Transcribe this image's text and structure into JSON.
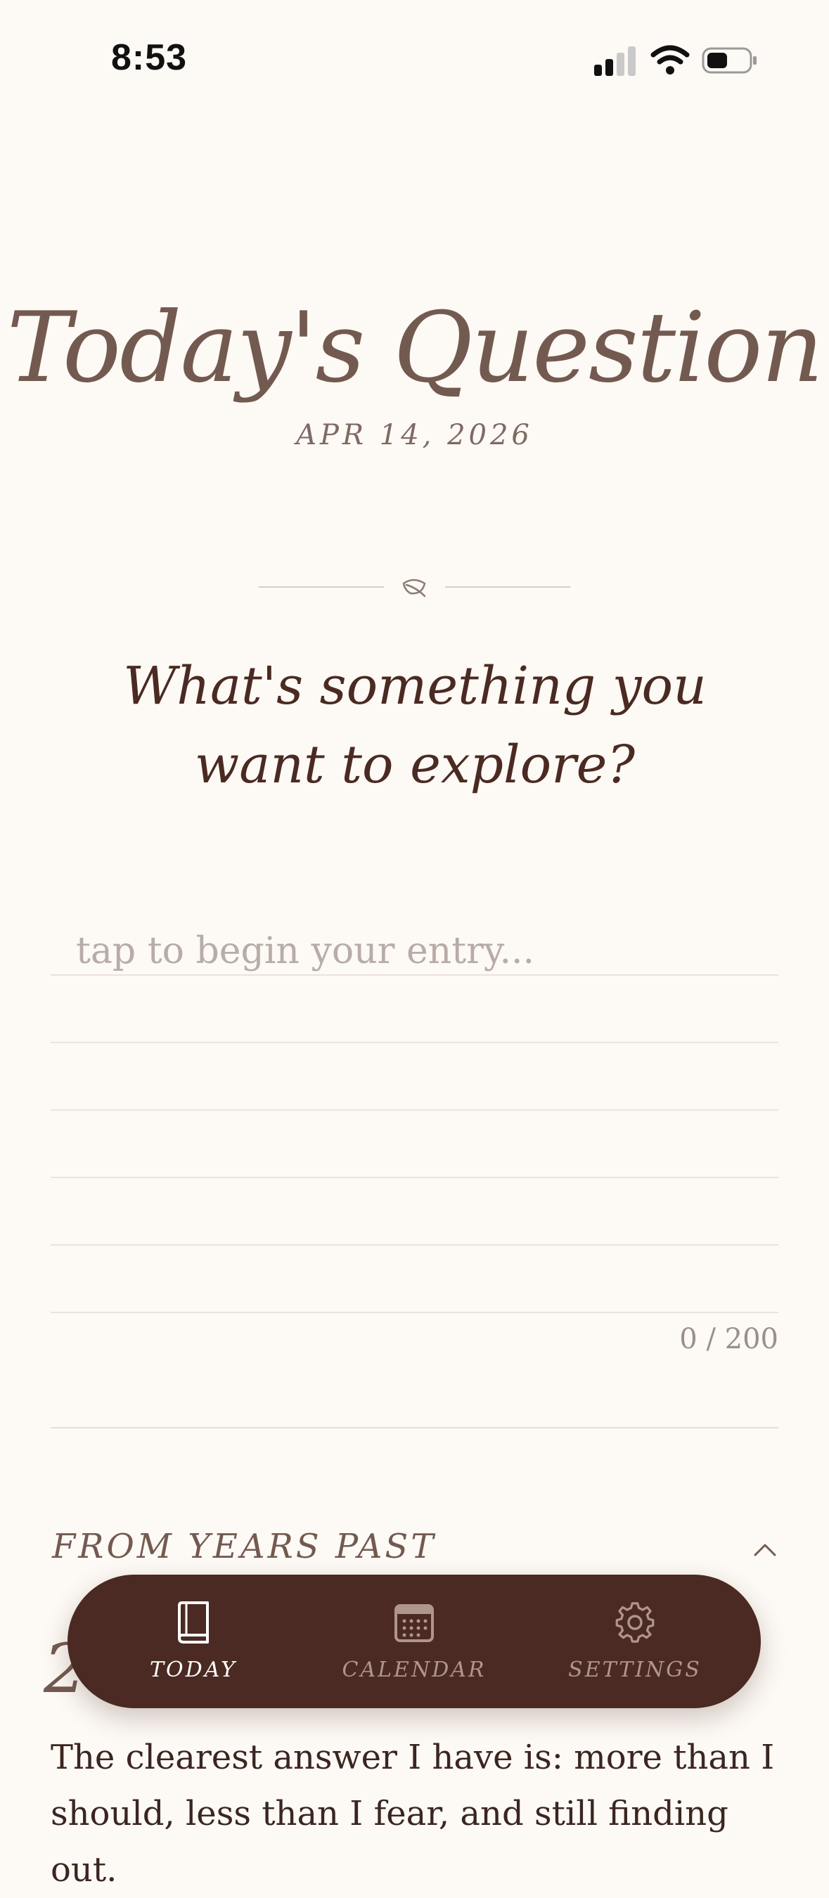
{
  "status_bar": {
    "time": "8:53"
  },
  "header": {
    "title": "Today's Question",
    "date": "APR 14, 2026"
  },
  "question": {
    "text": "What's something you want to explore?"
  },
  "entry": {
    "placeholder": "tap to begin your entry...",
    "value": "",
    "char_count": "0 / 200"
  },
  "past": {
    "heading": "FROM YEARS PAST",
    "partial_glyph": "2",
    "answer_preview": "The clearest answer I have is: more than I should, less than I fear, and still finding out."
  },
  "tab_bar": {
    "tabs": [
      {
        "label": "TODAY",
        "icon": "book-icon",
        "active": true
      },
      {
        "label": "CALENDAR",
        "icon": "calendar-icon",
        "active": false
      },
      {
        "label": "SETTINGS",
        "icon": "gear-icon",
        "active": false
      }
    ]
  },
  "colors": {
    "background": "#fdf9f4",
    "accent_dark": "#4a2a22",
    "title": "#735a50",
    "tab_inactive": "#b0958c",
    "tab_active": "#ffffff"
  }
}
